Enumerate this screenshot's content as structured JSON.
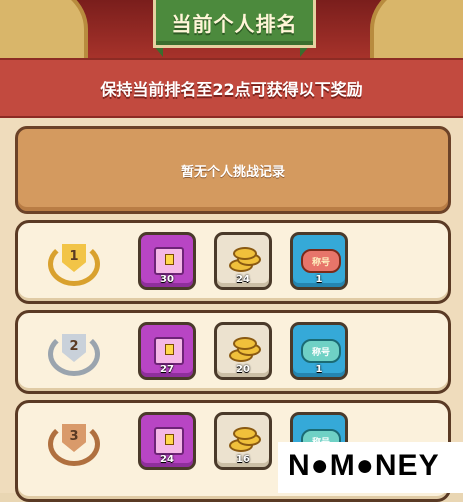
{
  "header": {
    "title": "当前个人排名",
    "subtitle": "保持当前排名至22点可获得以下奖励"
  },
  "no_record": "暂无个人挑战记录",
  "ranks": [
    {
      "rank": "1",
      "medal_color": "#e8b53a",
      "rewards": [
        {
          "type": "chest",
          "icon": "chest-icon",
          "qty": "30"
        },
        {
          "type": "coins",
          "icon": "coins-icon",
          "qty": "24"
        },
        {
          "type": "title",
          "icon": "title-badge-icon",
          "label": "称号",
          "qty": "1"
        }
      ]
    },
    {
      "rank": "2",
      "medal_color": "#b9c2cc",
      "rewards": [
        {
          "type": "chest",
          "icon": "chest-icon",
          "qty": "27"
        },
        {
          "type": "coins",
          "icon": "coins-icon",
          "qty": "20"
        },
        {
          "type": "title",
          "icon": "title-badge-icon",
          "label": "称号",
          "qty": "1"
        }
      ]
    },
    {
      "rank": "3",
      "medal_color": "#c98a5b",
      "rewards": [
        {
          "type": "chest",
          "icon": "chest-icon",
          "qty": "24"
        },
        {
          "type": "coins",
          "icon": "coins-icon",
          "qty": "16"
        },
        {
          "type": "title",
          "icon": "title-badge-icon",
          "label": "称号",
          "qty": ""
        }
      ]
    }
  ],
  "watermark": "N●M●NEY"
}
